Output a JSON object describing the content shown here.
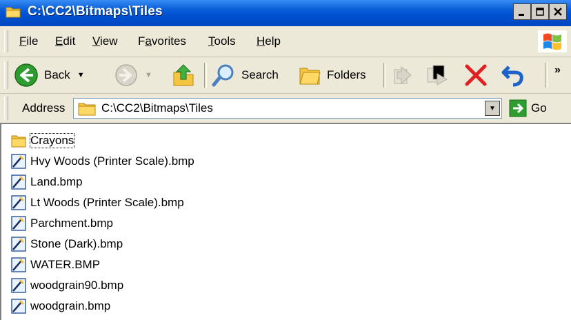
{
  "window": {
    "title": "C:\\CC2\\Bitmaps\\Tiles",
    "controls": [
      "minimize",
      "maximize",
      "close"
    ]
  },
  "menu": {
    "items": [
      {
        "label": "File",
        "access": "F"
      },
      {
        "label": "Edit",
        "access": "E"
      },
      {
        "label": "View",
        "access": "V"
      },
      {
        "label": "Favorites",
        "access": "a"
      },
      {
        "label": "Tools",
        "access": "T"
      },
      {
        "label": "Help",
        "access": "H"
      }
    ]
  },
  "toolbar": {
    "back_label": "Back",
    "search_label": "Search",
    "folders_label": "Folders",
    "overflow": "»"
  },
  "address": {
    "label": "Address",
    "value": "C:\\CC2\\Bitmaps\\Tiles",
    "go_label": "Go"
  },
  "files": [
    {
      "name": "Crayons",
      "type": "folder"
    },
    {
      "name": "Hvy Woods (Printer Scale).bmp",
      "type": "bmp"
    },
    {
      "name": "Land.bmp",
      "type": "bmp"
    },
    {
      "name": "Lt Woods (Printer Scale).bmp",
      "type": "bmp"
    },
    {
      "name": "Parchment.bmp",
      "type": "bmp"
    },
    {
      "name": "Stone (Dark).bmp",
      "type": "bmp"
    },
    {
      "name": "WATER.BMP",
      "type": "bmp"
    },
    {
      "name": "woodgrain90.bmp",
      "type": "bmp"
    },
    {
      "name": "woodgrain.bmp",
      "type": "bmp"
    }
  ],
  "colors": {
    "titlebar": "#0a5fd9",
    "chrome": "#ece9d8",
    "folder": "#f5c542",
    "back_green": "#2e9c2e",
    "delete_red": "#e02020"
  }
}
